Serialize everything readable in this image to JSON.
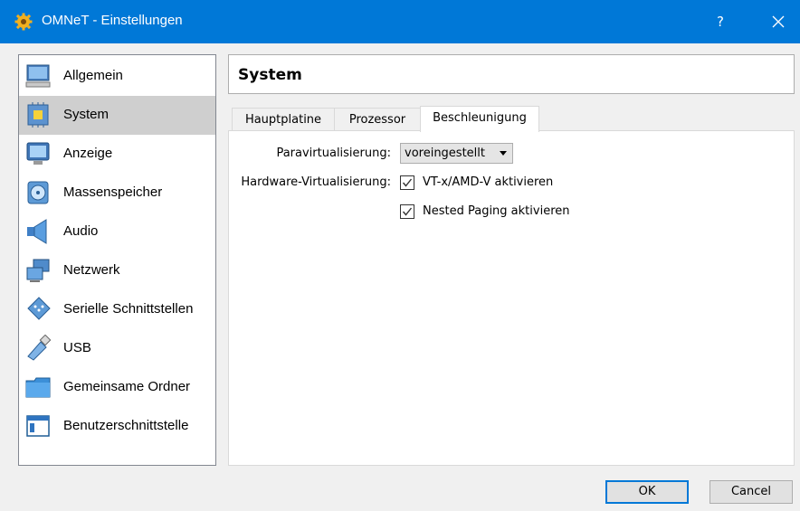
{
  "window": {
    "title": "OMNeT - Einstellungen",
    "help_label": "?",
    "accent_color": "#0078d7"
  },
  "sidebar": {
    "items": [
      {
        "label": "Allgemein",
        "icon": "computer-monitor-icon",
        "selected": false
      },
      {
        "label": "System",
        "icon": "chip-icon",
        "selected": true
      },
      {
        "label": "Anzeige",
        "icon": "display-icon",
        "selected": false
      },
      {
        "label": "Massenspeicher",
        "icon": "disk-icon",
        "selected": false
      },
      {
        "label": "Audio",
        "icon": "speaker-icon",
        "selected": false
      },
      {
        "label": "Netzwerk",
        "icon": "network-icon",
        "selected": false
      },
      {
        "label": "Serielle Schnittstellen",
        "icon": "serial-port-icon",
        "selected": false
      },
      {
        "label": "USB",
        "icon": "usb-icon",
        "selected": false
      },
      {
        "label": "Gemeinsame Ordner",
        "icon": "folder-icon",
        "selected": false
      },
      {
        "label": "Benutzerschnittstelle",
        "icon": "window-icon",
        "selected": false
      }
    ]
  },
  "page": {
    "title": "System",
    "tabs": [
      {
        "label": "Hauptplatine",
        "active": false
      },
      {
        "label": "Prozessor",
        "active": false
      },
      {
        "label": "Beschleunigung",
        "active": true
      }
    ],
    "paravirt": {
      "label": "Paravirtualisierung:",
      "value": "voreingestellt"
    },
    "hwvirt": {
      "label": "Hardware-Virtualisierung:",
      "vtx_label": "VT-x/AMD-V aktivieren",
      "vtx_checked": true,
      "nested_label": "Nested Paging aktivieren",
      "nested_checked": true
    }
  },
  "buttons": {
    "ok": "OK",
    "cancel": "Cancel"
  }
}
